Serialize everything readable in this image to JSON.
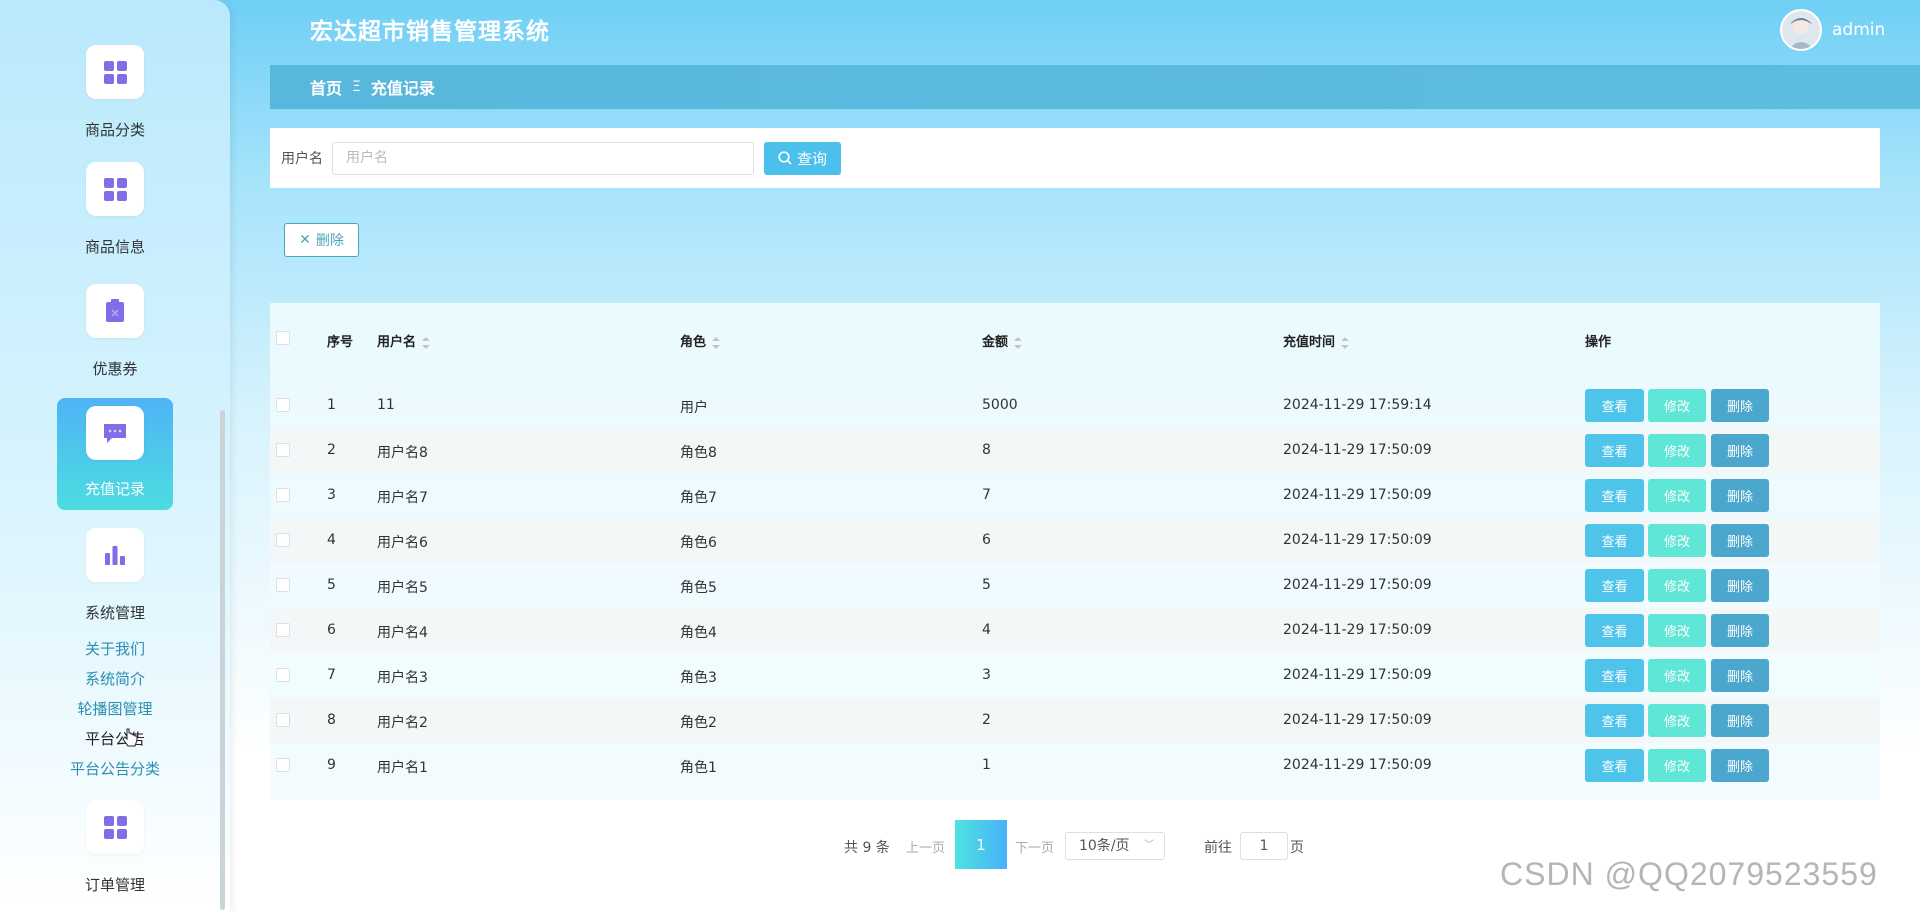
{
  "app": {
    "title": "宏达超市销售管理系统",
    "username": "admin"
  },
  "sidebar": {
    "items": [
      {
        "label": "商品分类",
        "icon": "grid-icon"
      },
      {
        "label": "商品信息",
        "icon": "grid-icon"
      },
      {
        "label": "优惠券",
        "icon": "coupon-icon"
      },
      {
        "label": "充值记录",
        "icon": "chat-icon",
        "active": true
      },
      {
        "label": "系统管理",
        "icon": "bar-chart-icon"
      },
      {
        "label": "订单管理",
        "icon": "grid-icon"
      }
    ],
    "sub_items": [
      "关于我们",
      "系统简介",
      "轮播图管理",
      "平台公告",
      "平台公告分类"
    ]
  },
  "breadcrumb": {
    "home": "首页",
    "separator": "Ξ",
    "current": "充值记录"
  },
  "search": {
    "label": "用户名",
    "placeholder": "用户名",
    "button": "查询"
  },
  "actions": {
    "delete": "删除"
  },
  "table": {
    "headers": {
      "index": "序号",
      "username": "用户名",
      "role": "角色",
      "amount": "金额",
      "time": "充值时间",
      "ops": "操作"
    },
    "op_labels": {
      "view": "查看",
      "edit": "修改",
      "delete": "删除"
    },
    "rows": [
      {
        "index": "1",
        "username": "11",
        "role": "用户",
        "amount": "5000",
        "time": "2024-11-29 17:59:14"
      },
      {
        "index": "2",
        "username": "用户名8",
        "role": "角色8",
        "amount": "8",
        "time": "2024-11-29 17:50:09"
      },
      {
        "index": "3",
        "username": "用户名7",
        "role": "角色7",
        "amount": "7",
        "time": "2024-11-29 17:50:09"
      },
      {
        "index": "4",
        "username": "用户名6",
        "role": "角色6",
        "amount": "6",
        "time": "2024-11-29 17:50:09"
      },
      {
        "index": "5",
        "username": "用户名5",
        "role": "角色5",
        "amount": "5",
        "time": "2024-11-29 17:50:09"
      },
      {
        "index": "6",
        "username": "用户名4",
        "role": "角色4",
        "amount": "4",
        "time": "2024-11-29 17:50:09"
      },
      {
        "index": "7",
        "username": "用户名3",
        "role": "角色3",
        "amount": "3",
        "time": "2024-11-29 17:50:09"
      },
      {
        "index": "8",
        "username": "用户名2",
        "role": "角色2",
        "amount": "2",
        "time": "2024-11-29 17:50:09"
      },
      {
        "index": "9",
        "username": "用户名1",
        "role": "角色1",
        "amount": "1",
        "time": "2024-11-29 17:50:09"
      }
    ]
  },
  "pagination": {
    "total": "共 9 条",
    "prev": "上一页",
    "current": "1",
    "next": "下一页",
    "page_size": "10条/页",
    "goto": "前往",
    "goto_value": "1",
    "page_unit": "页"
  },
  "watermark": "CSDN @QQ2079523559",
  "colors": {
    "accent": "#4cc0ec",
    "view": "#4fc4ea",
    "edit": "#60e6d6",
    "delete": "#4ba7cd",
    "breadcrumb": "#58b7dc"
  }
}
